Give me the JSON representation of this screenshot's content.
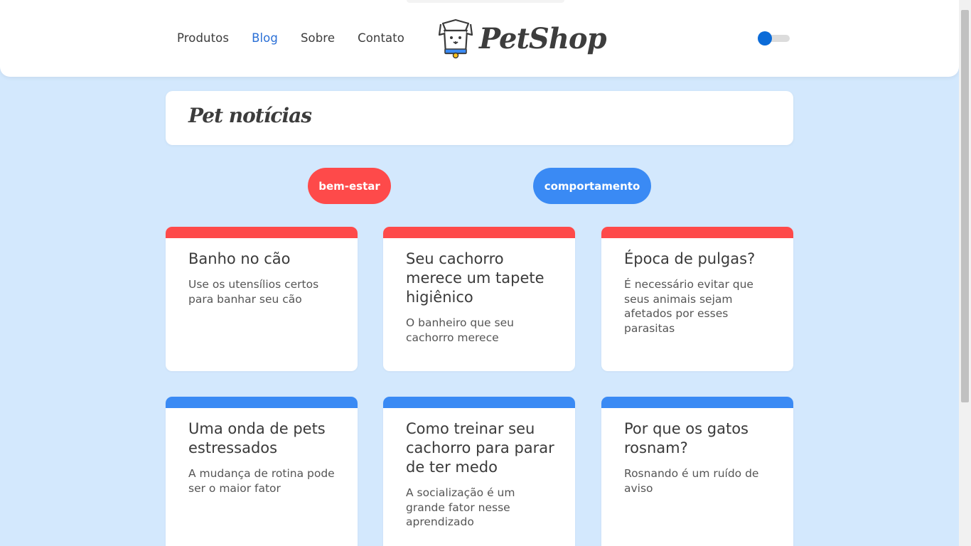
{
  "nav": {
    "items": [
      {
        "label": "Produtos",
        "active": false
      },
      {
        "label": "Blog",
        "active": true
      },
      {
        "label": "Sobre",
        "active": false
      },
      {
        "label": "Contato",
        "active": false
      }
    ]
  },
  "logo": {
    "text": "PetShop",
    "icon": "dog-in-box-icon"
  },
  "theme_toggle": {
    "icon": "toggle-switch",
    "on": false
  },
  "page_title": "Pet notícias",
  "filters": [
    {
      "label": "bem-estar",
      "color": "#fe4a4a"
    },
    {
      "label": "comportamento",
      "color": "#3a8af4"
    }
  ],
  "cards": [
    {
      "title": "Banho no cão",
      "text": "Use os utensílios certos para banhar seu cão",
      "category": "bem-estar"
    },
    {
      "title": "Seu cachorro merece um tapete higiênico",
      "text": "O banheiro que seu cachorro merece",
      "category": "bem-estar"
    },
    {
      "title": "Época de pulgas?",
      "text": "É necessário evitar que seus animais sejam afetados por esses parasitas",
      "category": "bem-estar"
    },
    {
      "title": "Uma onda de pets estressados",
      "text": "A mudança de rotina pode ser o maior fator",
      "category": "comportamento"
    },
    {
      "title": "Como treinar seu cachorro para parar de ter medo",
      "text": "A socialização é um grande fator nesse aprendizado",
      "category": "comportamento"
    },
    {
      "title": "Por que os gatos rosnam?",
      "text": "Rosnando é um ruído de aviso",
      "category": "comportamento"
    }
  ],
  "colors": {
    "background": "#d3e8fd",
    "accent_red": "#fe4a4a",
    "accent_blue": "#3a8af4",
    "link_active": "#2a6fd6",
    "toggle_knob": "#0b6bd8"
  }
}
